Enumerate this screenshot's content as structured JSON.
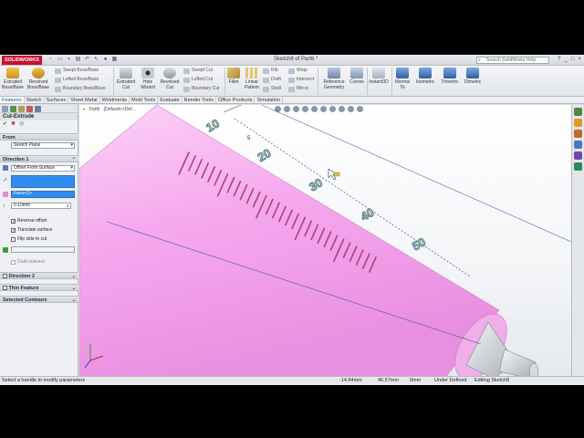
{
  "app": {
    "logo": "SOLIDWORKS",
    "document_title": "Sketch8 of Part6 *",
    "search_placeholder": "Search SolidWorks Help"
  },
  "window_buttons": [
    "?",
    "_",
    "□",
    "×"
  ],
  "ribbon": {
    "big_buttons": [
      {
        "label": "Extruded Boss/Base",
        "icon": "extruded-boss-icon"
      },
      {
        "label": "Revolved Boss/Base",
        "icon": "revolved-boss-icon"
      },
      {
        "label": "Extruded Cut",
        "icon": "extruded-cut-icon"
      },
      {
        "label": "Hole Wizard",
        "icon": "hole-wizard-icon"
      },
      {
        "label": "Revolved Cut",
        "icon": "revolved-cut-icon"
      },
      {
        "label": "Fillet",
        "icon": "fillet-icon"
      },
      {
        "label": "Linear Pattern",
        "icon": "linear-pattern-icon"
      },
      {
        "label": "Reference Geometry",
        "icon": "reference-geometry-icon"
      },
      {
        "label": "Curves",
        "icon": "curves-icon"
      },
      {
        "label": "Instant3D",
        "icon": "instant3d-icon"
      },
      {
        "label": "Normal To",
        "icon": "normal-to-icon"
      },
      {
        "label": "Isometric",
        "icon": "isometric-icon"
      },
      {
        "label": "Trimetric",
        "icon": "trimetric-icon"
      },
      {
        "label": "Dimetric",
        "icon": "dimetric-icon"
      }
    ],
    "small_buttons": [
      "Swept Boss/Base",
      "Lofted Boss/Base",
      "Boundary Boss/Base",
      "Swept Cut",
      "Lofted Cut",
      "Boundary Cut",
      "Rib",
      "Draft",
      "Shell",
      "Wrap",
      "Intersect",
      "Mirror"
    ]
  },
  "tabs": [
    "Features",
    "Sketch",
    "Surfaces",
    "Sheet Metal",
    "Weldments",
    "Mold Tools",
    "Evaluate",
    "Render Tools",
    "Office Products",
    "Simulation"
  ],
  "property_manager": {
    "title": "Cut-Extrude",
    "from_label": "From",
    "from_value": "Sketch Plane",
    "direction1_label": "Direction 1",
    "direction1_type": "Offset From Surface",
    "face_value": "Face<1>",
    "offset_value": "0.10mm",
    "checkboxes": [
      {
        "label": "Reverse offset",
        "checked": true
      },
      {
        "label": "Translate surface",
        "checked": true
      },
      {
        "label": "Flip side to cut",
        "checked": false
      }
    ],
    "draft_outward": "Draft outward",
    "direction2_label": "Direction 2",
    "thin_feature_label": "Thin Feature",
    "selected_contours_label": "Selected Contours"
  },
  "viewport": {
    "breadcrumb": [
      "Part6",
      "(Default<<Def..."
    ],
    "dimension_label": "5",
    "scale_numbers": [
      "10",
      "20",
      "30",
      "40",
      "50"
    ]
  },
  "status": {
    "message": "Select a handle to modify parameters",
    "x": "-14.64mm",
    "y": "46.57mm",
    "z": "0mm",
    "state": "Under Defined",
    "editing": "Editing Sketch8"
  },
  "colors": {
    "barrel": "#f6a9ee",
    "accent": "#1a4f8a",
    "selection": "#2f8cf0"
  }
}
